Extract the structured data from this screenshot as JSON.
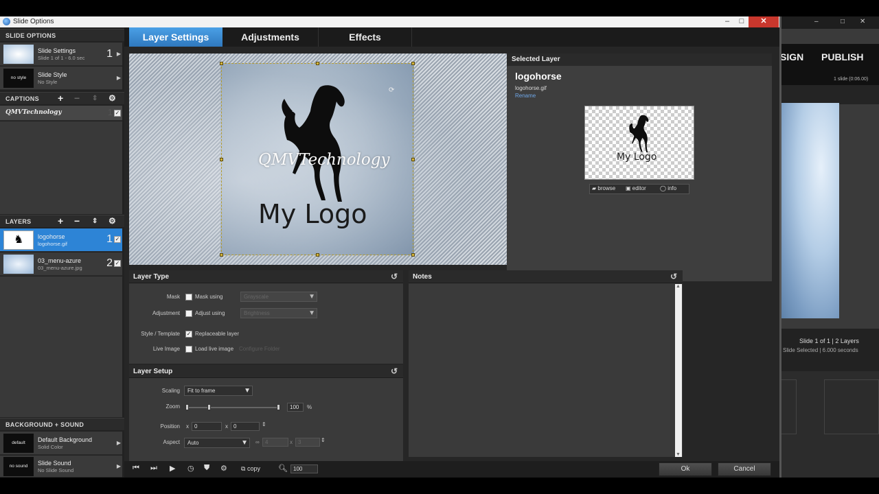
{
  "window": {
    "title": "Slide Options",
    "minimize": "–",
    "maximize": "□",
    "close": "✕"
  },
  "tabs": [
    "Layer Settings",
    "Adjustments",
    "Effects"
  ],
  "background_app": {
    "nav_design": "SIGN",
    "nav_publish": "PUBLISH",
    "slide_count_time": "1 slide (0:06.00)",
    "status_line1": "Slide 1 of 1  |  2 Layers",
    "status_line2": "Slide Selected  |  6.000 seconds",
    "win_min": "–",
    "win_max": "□",
    "win_close": "✕"
  },
  "left": {
    "slide_options_header": "SLIDE OPTIONS",
    "slide_settings": {
      "name": "Slide Settings",
      "sub": "Slide 1 of 1 - 6.0 sec",
      "num": "1"
    },
    "slide_style": {
      "thumb": "no style",
      "name": "Slide Style",
      "sub": "No Style"
    },
    "captions_header": "CAPTIONS",
    "caption": {
      "name": "QMVTechnology",
      "num": "1"
    },
    "layers_header": "LAYERS",
    "layers": [
      {
        "name": "logohorse",
        "file": "logohorse.gif",
        "num": "1"
      },
      {
        "name": "03_menu-azure",
        "file": "03_menu-azure.jpg",
        "num": "2"
      }
    ],
    "bg_sound_header": "BACKGROUND + SOUND",
    "background": {
      "thumb": "default",
      "name": "Default Background",
      "sub": "Solid Color"
    },
    "sound": {
      "thumb": "no sound",
      "name": "Slide Sound",
      "sub": "No Slide Sound"
    }
  },
  "preview": {
    "caption_text": "QMVTechnology",
    "logo_text": "My Logo"
  },
  "selected_layer": {
    "header": "Selected Layer",
    "name": "logohorse",
    "file": "logohorse.gif",
    "rename": "Rename",
    "thumb_text": "My Logo",
    "btn_browse": "browse",
    "btn_editor": "editor",
    "btn_info": "info"
  },
  "layer_type": {
    "header": "Layer Type",
    "mask_label": "Mask",
    "mask_check": "Mask using",
    "mask_select": "Grayscale",
    "adjust_label": "Adjustment",
    "adjust_check": "Adjust using",
    "adjust_select": "Brightness",
    "style_label": "Style / Template",
    "style_check": "Replaceable layer",
    "live_label": "Live Image",
    "live_check": "Load live image",
    "live_btn": "Configure Folder"
  },
  "layer_setup": {
    "header": "Layer Setup",
    "scaling_label": "Scaling",
    "scaling_value": "Fit to frame",
    "zoom_label": "Zoom",
    "zoom_value": "100",
    "zoom_unit": "%",
    "position_label": "Position",
    "pos_x_prefix": "x",
    "pos_x": "0",
    "pos_y_prefix": "x",
    "pos_y": "0",
    "aspect_label": "Aspect",
    "aspect_value": "Auto",
    "asp_a": "4",
    "asp_b": "3",
    "asp_x": "x"
  },
  "notes": {
    "header": "Notes"
  },
  "bottom": {
    "copy_label": "copy",
    "zoom_value": "100",
    "ok": "Ok",
    "cancel": "Cancel"
  },
  "colors": {
    "accent": "#2d84d6",
    "tab_active": "#3a8fd6",
    "close": "#c8372d"
  }
}
